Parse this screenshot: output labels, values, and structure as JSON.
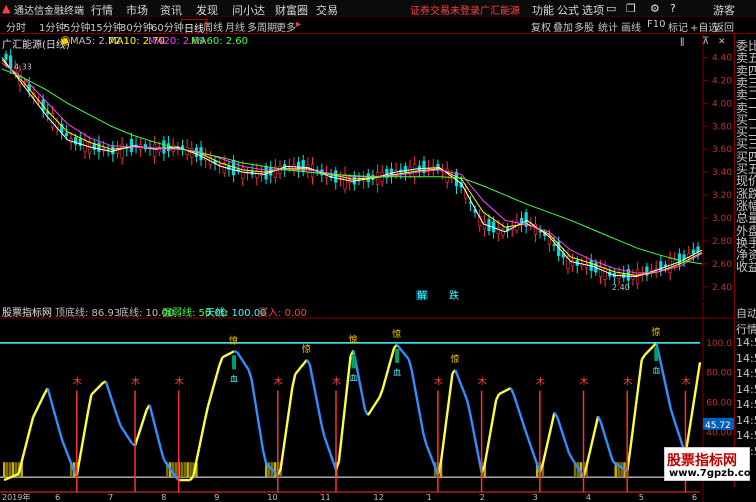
{
  "app": {
    "title": "通达信金融终端",
    "menu": [
      "行情",
      "市场",
      "资讯",
      "发现",
      "问小达",
      "财富圈",
      "交易"
    ],
    "alert": "证券交易未登录",
    "broker": "广汇能源",
    "right_menu": [
      "功能",
      "公式",
      "选项",
      "游客"
    ],
    "colors": {
      "bg": "#000000",
      "up": "#ff3030",
      "down": "#00e0e0",
      "accent": "#c00000"
    }
  },
  "tabs": [
    "分时",
    "1分钟",
    "5分钟",
    "15分钟",
    "30分钟",
    "60分钟",
    "日线",
    "周线",
    "月线",
    "多周期",
    "更多"
  ],
  "active_tab": "日线",
  "toolbar": [
    "复权",
    "叠加",
    "多股",
    "统计",
    "画线",
    "F10",
    "标记",
    "+自选",
    "返回"
  ],
  "main": {
    "title": "广汇能源(日线)",
    "ma": [
      {
        "label": "MA5: 2.72",
        "color": "#ffffff"
      },
      {
        "label": "MA10: 2.70",
        "color": "#ffff00"
      },
      {
        "label": "MA20: 2.69",
        "color": "#ff40ff"
      },
      {
        "label": "MA60: 2.60",
        "color": "#40ff40"
      }
    ],
    "high_label": "4.33",
    "low_label": "2.40",
    "markers": [
      "解",
      "跌"
    ],
    "y_ticks": [
      "4.40",
      "4.20",
      "4.00",
      "3.80",
      "3.60",
      "3.40",
      "3.20",
      "3.00",
      "2.80",
      "2.60",
      "2.40"
    ]
  },
  "indicator": {
    "name": "股票指标网",
    "items": [
      {
        "label": "顶底线: 86.93",
        "color": "#ffffff"
      },
      {
        "label": "底线: 10.00",
        "color": "#ffffff"
      },
      {
        "label": "强弱线: 50.00",
        "color": "#40ff40"
      },
      {
        "label": "天线: 100.00",
        "color": "#40ffff"
      },
      {
        "label": "买入: 0.00",
        "color": "#ff4040"
      }
    ],
    "y_ticks": [
      "100.0",
      "80.00",
      "60.00",
      "40.00",
      "20.00"
    ],
    "current": "45.72",
    "signals": {
      "buy": "木",
      "caution": "惊",
      "down_mark": "血"
    }
  },
  "side": {
    "items": [
      "委比",
      "卖五",
      "卖四",
      "卖三",
      "卖二",
      "卖一",
      "买一",
      "买二",
      "买三",
      "买四",
      "买五",
      "现价",
      "涨跌",
      "涨幅",
      "总量",
      "外盘",
      "换手",
      "净资",
      "收益"
    ],
    "bottom": [
      "自动",
      "行情",
      "14:5",
      "14:5",
      "14:5",
      "14:5",
      "14:5",
      "14:5",
      "14:5",
      "14:5"
    ]
  },
  "time_axis": [
    "2019年",
    "6",
    "7",
    "8",
    "9",
    "10",
    "11",
    "12",
    "1",
    "2",
    "3",
    "4",
    "5",
    "6"
  ],
  "watermark": {
    "line1": "股票指标网",
    "line2": "www.7gpzb.com"
  },
  "chart_data": [
    {
      "type": "line",
      "title": "广汇能源(日线)",
      "series": [
        {
          "name": "MA5",
          "color": "#ffffff",
          "values": [
            4.4,
            4.15,
            3.9,
            3.68,
            3.62,
            3.58,
            3.63,
            3.6,
            3.62,
            3.55,
            3.45,
            3.4,
            3.38,
            3.45,
            3.44,
            3.36,
            3.32,
            3.35,
            3.4,
            3.43,
            3.44,
            3.3,
            2.95,
            2.88,
            2.98,
            2.84,
            2.62,
            2.58,
            2.5,
            2.49,
            2.55,
            2.62,
            2.72
          ]
        },
        {
          "name": "MA10",
          "color": "#ffff00",
          "values": [
            4.38,
            4.18,
            3.95,
            3.75,
            3.66,
            3.6,
            3.62,
            3.61,
            3.61,
            3.57,
            3.48,
            3.42,
            3.4,
            3.43,
            3.43,
            3.38,
            3.34,
            3.35,
            3.38,
            3.41,
            3.43,
            3.34,
            3.05,
            2.92,
            2.95,
            2.86,
            2.66,
            2.6,
            2.53,
            2.5,
            2.53,
            2.6,
            2.7
          ]
        },
        {
          "name": "MA20",
          "color": "#ff40ff",
          "values": [
            4.35,
            4.22,
            4.02,
            3.82,
            3.7,
            3.63,
            3.62,
            3.61,
            3.6,
            3.58,
            3.52,
            3.45,
            3.42,
            3.42,
            3.42,
            3.39,
            3.36,
            3.36,
            3.37,
            3.4,
            3.42,
            3.38,
            3.15,
            2.98,
            2.94,
            2.88,
            2.72,
            2.63,
            2.56,
            2.52,
            2.53,
            2.58,
            2.69
          ]
        },
        {
          "name": "MA60",
          "color": "#40ff40",
          "values": [
            4.3,
            4.22,
            4.12,
            4.0,
            3.9,
            3.8,
            3.72,
            3.66,
            3.61,
            3.57,
            3.53,
            3.48,
            3.45,
            3.42,
            3.4,
            3.38,
            3.37,
            3.36,
            3.36,
            3.36,
            3.36,
            3.35,
            3.28,
            3.2,
            3.12,
            3.05,
            2.98,
            2.9,
            2.82,
            2.74,
            2.68,
            2.63,
            2.6
          ]
        }
      ],
      "ylim": [
        2.32,
        4.5
      ]
    },
    {
      "type": "line",
      "title": "股票指标网",
      "series": [
        {
          "name": "顶底线",
          "values": [
            8,
            12,
            50,
            70,
            35,
            10,
            65,
            75,
            45,
            30,
            60,
            22,
            8,
            8,
            55,
            90,
            95,
            80,
            20,
            10,
            78,
            90,
            40,
            12,
            100,
            50,
            65,
            100,
            88,
            35,
            10,
            85,
            60,
            10,
            65,
            70,
            40,
            12,
            55,
            25,
            10,
            52,
            20,
            14,
            90,
            100,
            55,
            25,
            87
          ]
        },
        {
          "name": "强弱线",
          "values": [
            50,
            50,
            50,
            50,
            50,
            50,
            50,
            50,
            50,
            50,
            50,
            50,
            50,
            50,
            50,
            50,
            50,
            50,
            50,
            50,
            50,
            50,
            50,
            50,
            50,
            50,
            50,
            50,
            50,
            50,
            50,
            50,
            50,
            50,
            50,
            50,
            50,
            50,
            50,
            50,
            50,
            50,
            50,
            50,
            50,
            50,
            50,
            50,
            50
          ]
        }
      ],
      "ylim": [
        0,
        110
      ]
    }
  ]
}
